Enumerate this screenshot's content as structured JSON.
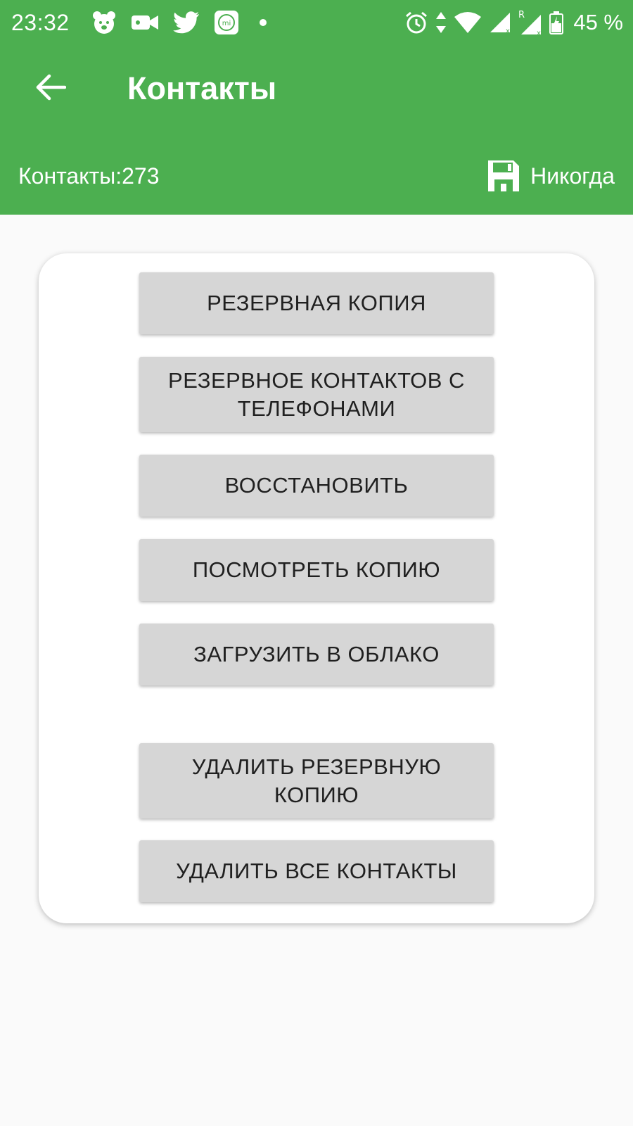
{
  "status_bar": {
    "time": "23:32",
    "battery_percent": "45 %",
    "left_icons": [
      "bear-app-icon",
      "video-camera-icon",
      "twitter-icon",
      "mi-app-icon",
      "dot-icon"
    ],
    "right_icons": [
      "alarm-icon",
      "data-arrows-icon",
      "wifi-icon",
      "signal-icon",
      "roaming-signal-icon",
      "battery-icon"
    ]
  },
  "app_bar": {
    "back_icon": "arrow-left-icon",
    "title": "Контакты"
  },
  "info_bar": {
    "contacts_count": "Контакты:273",
    "save_icon": "floppy-disk-icon",
    "last_backup": "Никогда"
  },
  "actions": {
    "backup": "РЕЗЕРВНАЯ КОПИЯ",
    "backup_with_phones": "РЕЗЕРВНОЕ КОНТАКТОВ С ТЕЛЕФОНАМИ",
    "restore": "ВОССТАНОВИТЬ",
    "view_backup": "ПОСМОТРЕТЬ КОПИЮ",
    "upload_cloud": "ЗАГРУЗИТЬ В ОБЛАКО",
    "delete_backup": "УДАЛИТЬ РЕЗЕРВНУЮ КОПИЮ",
    "delete_all": "УДАЛИТЬ ВСЕ КОНТАКТЫ"
  },
  "colors": {
    "primary": "#4caf50",
    "button_bg": "#d6d6d6",
    "button_text": "#202020",
    "page_bg": "#fafafa"
  }
}
